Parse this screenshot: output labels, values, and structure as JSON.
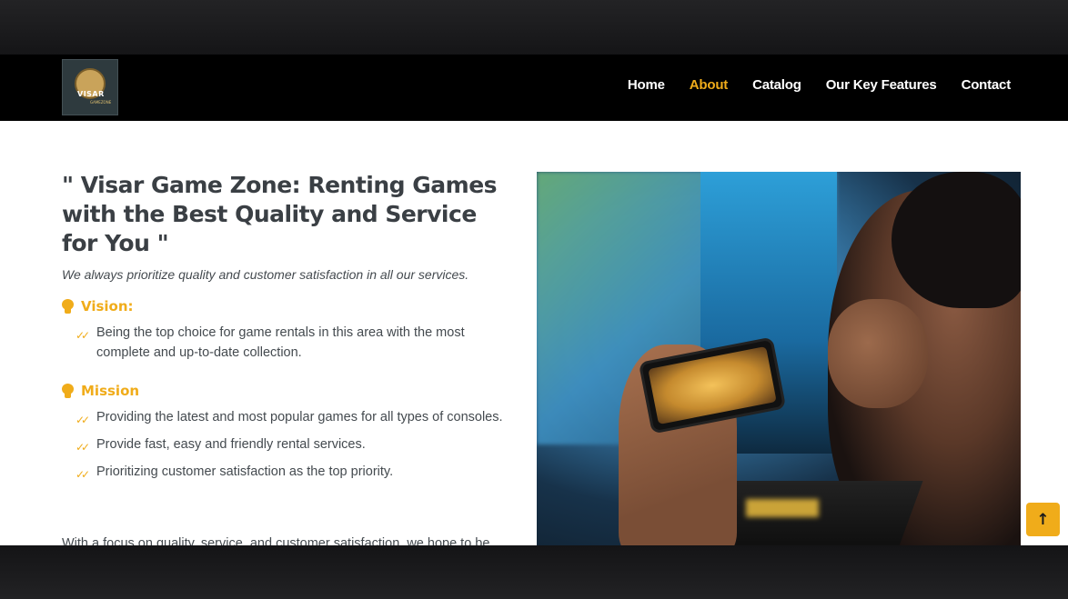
{
  "nav": {
    "logo_text": "VISAR",
    "logo_sub": "GAMEZONE",
    "items": [
      {
        "label": "Home",
        "active": false
      },
      {
        "label": "About",
        "active": true
      },
      {
        "label": "Catalog",
        "active": false
      },
      {
        "label": "Our Key Features",
        "active": false
      },
      {
        "label": "Contact",
        "active": false
      }
    ]
  },
  "about": {
    "headline": "\" Visar Game Zone: Renting Games with the Best Quality and Service for You \"",
    "tagline": "We always prioritize quality and customer satisfaction in all our services.",
    "vision": {
      "title": "Vision:",
      "items": [
        "Being the top choice for game rentals in this area with the most complete and up-to-date collection."
      ]
    },
    "mission": {
      "title": "Mission",
      "items": [
        "Providing the latest and most popular games for all types of consoles.",
        "Provide fast, easy and friendly rental services.",
        "Prioritizing customer satisfaction as the top priority."
      ]
    },
    "clipped_text": "With a focus on quality, service, and customer satisfaction, we hope to be"
  },
  "photo": {
    "icon": "gamer-photo"
  },
  "back_to_top": {
    "icon": "arrow-up-icon",
    "glyph": "↑"
  },
  "colors": {
    "accent": "#f0ac1a",
    "navbar": "#000000",
    "heading": "#3a3f44",
    "text": "#444a4f"
  }
}
